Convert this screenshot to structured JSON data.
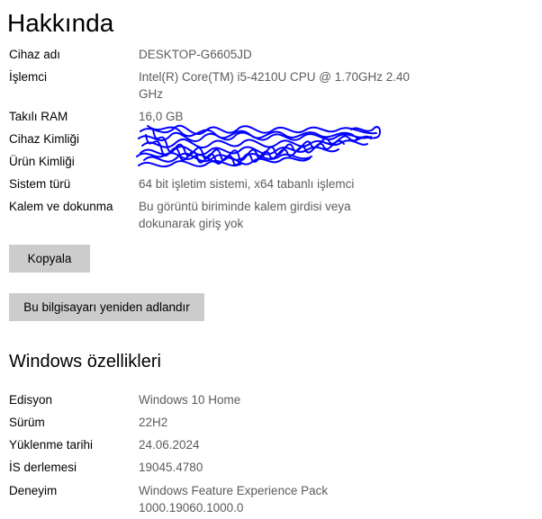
{
  "page": {
    "title": "Hakkında"
  },
  "device_specs": [
    {
      "label": "Cihaz adı",
      "value": "DESKTOP-G6605JD"
    },
    {
      "label": "İşlemci",
      "value": "Intel(R) Core(TM) i5-4210U CPU @ 1.70GHz   2.40 GHz"
    },
    {
      "label": "Takılı RAM",
      "value": "16,0 GB"
    },
    {
      "label": "Cihaz Kimliği",
      "value": ""
    },
    {
      "label": "Ürün Kimliği",
      "value": ""
    },
    {
      "label": "Sistem türü",
      "value": "64 bit işletim sistemi, x64 tabanlı işlemci"
    },
    {
      "label": "Kalem ve dokunma",
      "value": "Bu görüntü biriminde kalem girdisi veya dokunarak giriş yok"
    }
  ],
  "buttons": {
    "copy": "Kopyala",
    "rename": "Bu bilgisayarı yeniden adlandır"
  },
  "windows_specs": {
    "title": "Windows özellikleri",
    "rows": [
      {
        "label": "Edisyon",
        "value": "Windows 10 Home"
      },
      {
        "label": "Sürüm",
        "value": "22H2"
      },
      {
        "label": "Yüklenme tarihi",
        "value": "24.06.2024"
      },
      {
        "label": "İS derlemesi",
        "value": "19045.4780"
      },
      {
        "label": "Deneyim",
        "value": "Windows Feature Experience Pack 1000.19060.1000.0"
      }
    ]
  },
  "colors": {
    "value_text": "#5c5c5c",
    "button_bg": "#cccccc",
    "redaction_scribble": "#0000ff"
  }
}
